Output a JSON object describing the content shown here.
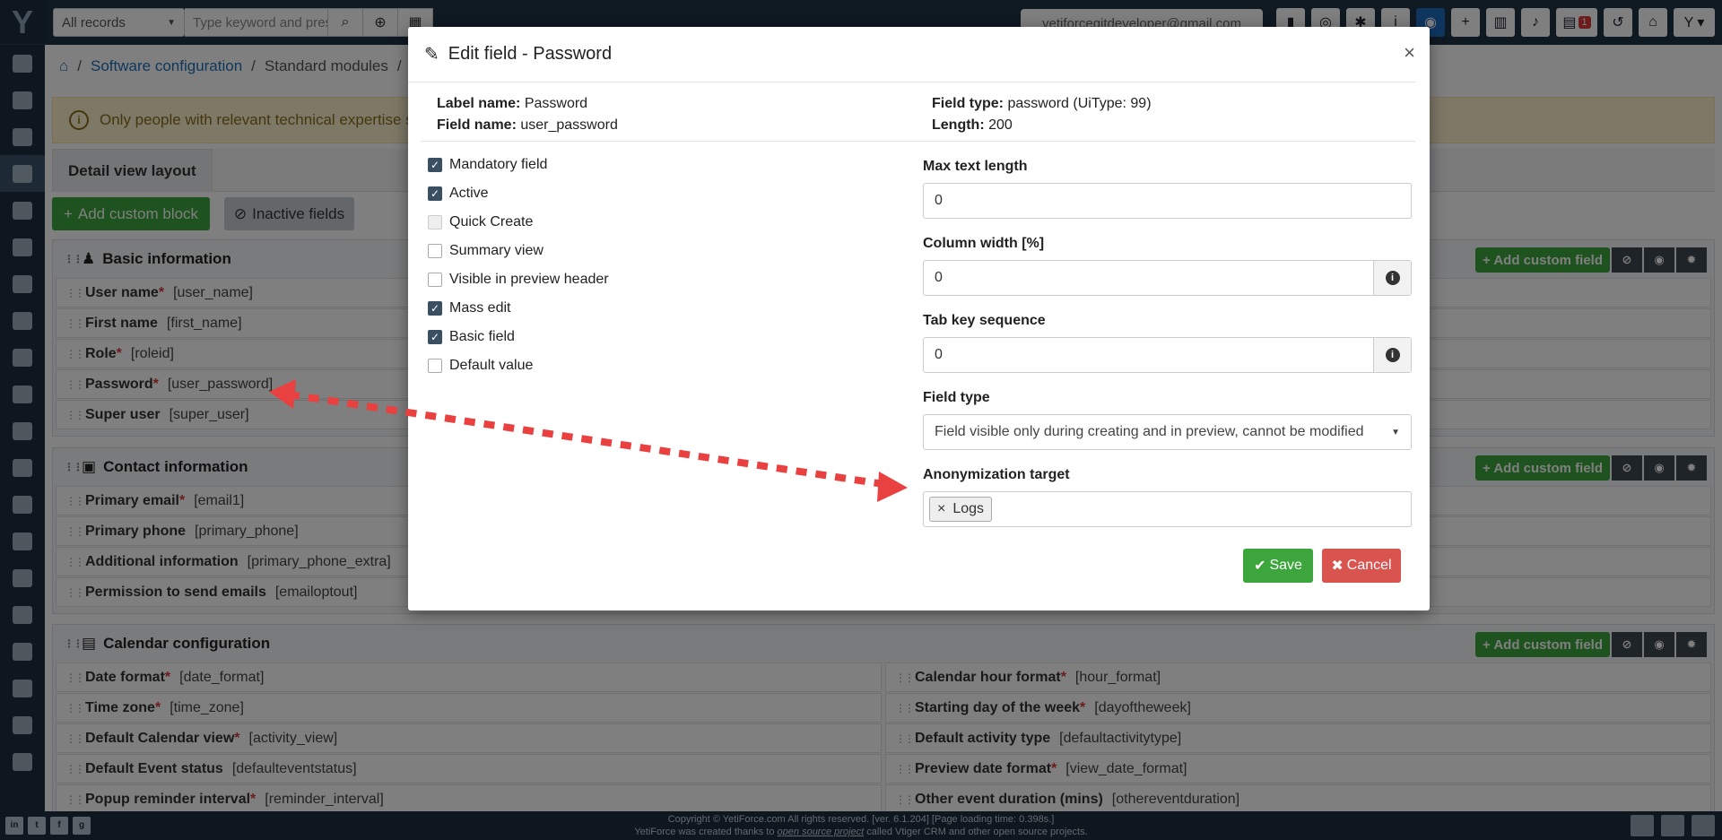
{
  "topbar": {
    "filter_select": "All records",
    "search_placeholder": "Type keyword and press",
    "user_email": "yetiforcegitdeveloper@gmail.com",
    "calendar_badge": "1"
  },
  "breadcrumb": [
    "Software configuration",
    "Standard modules"
  ],
  "alert_text": "Only people with relevant technical expertise sho",
  "tab_label": "Detail view layout",
  "actions": {
    "add_block": "Add custom block",
    "inactive_fields": "Inactive fields",
    "add_field": "Add custom field"
  },
  "blocks": {
    "basic": {
      "title": "Basic information",
      "fields": [
        {
          "name": "User name",
          "required": true,
          "key": "[user_name]"
        },
        {
          "name": "First name",
          "required": false,
          "key": "[first_name]"
        },
        {
          "name": "Role",
          "required": true,
          "key": "[roleid]"
        },
        {
          "name": "Password",
          "required": true,
          "key": "[user_password]"
        },
        {
          "name": "Super user",
          "required": false,
          "key": "[super_user]"
        }
      ]
    },
    "contact": {
      "title": "Contact information",
      "fields": [
        {
          "name": "Primary email",
          "required": true,
          "key": "[email1]"
        },
        {
          "name": "Primary phone",
          "required": false,
          "key": "[primary_phone]"
        },
        {
          "name": "Additional information",
          "required": false,
          "key": "[primary_phone_extra]"
        },
        {
          "name": "Permission to send emails",
          "required": false,
          "key": "[emailoptout]"
        }
      ]
    },
    "calendar": {
      "title": "Calendar configuration",
      "left": [
        {
          "name": "Date format",
          "required": true,
          "key": "[date_format]"
        },
        {
          "name": "Time zone",
          "required": true,
          "key": "[time_zone]"
        },
        {
          "name": "Default Calendar view",
          "required": true,
          "key": "[activity_view]"
        },
        {
          "name": "Default Event status",
          "required": false,
          "key": "[defaulteventstatus]"
        },
        {
          "name": "Popup reminder interval",
          "required": true,
          "key": "[reminder_interval]"
        }
      ],
      "right": [
        {
          "name": "Calendar hour format",
          "required": true,
          "key": "[hour_format]"
        },
        {
          "name": "Starting day of the week",
          "required": true,
          "key": "[dayoftheweek]"
        },
        {
          "name": "Default activity type",
          "required": false,
          "key": "[defaultactivitytype]"
        },
        {
          "name": "Preview date format",
          "required": true,
          "key": "[view_date_format]"
        },
        {
          "name": "Other event duration (mins)",
          "required": false,
          "key": "[othereventduration]"
        }
      ]
    }
  },
  "modal": {
    "title": "Edit field - Password",
    "label_name_caption": "Label name:",
    "label_name": "Password",
    "field_name_caption": "Field name:",
    "field_name": "user_password",
    "field_type_caption": "Field type:",
    "field_type": "password (UiType: 99)",
    "length_caption": "Length:",
    "length": "200",
    "checkboxes": [
      {
        "label": "Mandatory field",
        "checked": true,
        "disabled": false
      },
      {
        "label": "Active",
        "checked": true,
        "disabled": false
      },
      {
        "label": "Quick Create",
        "checked": false,
        "disabled": true
      },
      {
        "label": "Summary view",
        "checked": false,
        "disabled": false
      },
      {
        "label": "Visible in preview header",
        "checked": false,
        "disabled": false
      },
      {
        "label": "Mass edit",
        "checked": true,
        "disabled": false
      },
      {
        "label": "Basic field",
        "checked": true,
        "disabled": false
      },
      {
        "label": "Default value",
        "checked": false,
        "disabled": false
      }
    ],
    "max_text_length_label": "Max text length",
    "max_text_length": "0",
    "column_width_label": "Column width [%]",
    "column_width": "0",
    "tab_key_label": "Tab key sequence",
    "tab_key": "0",
    "field_type_label": "Field type",
    "field_type_select": "Field visible only during creating and in preview, cannot be modified",
    "anonymization_label": "Anonymization target",
    "anonymization_tag": "Logs",
    "save": "Save",
    "cancel": "Cancel"
  },
  "footer": {
    "line1": "Copyright © YetiForce.com All rights reserved. [ver. 6.1.204] [Page loading time: 0.398s.]",
    "line2_pre": "YetiForce was created thanks to ",
    "line2_link": "open source project",
    "line2_post": " called Vtiger CRM and other open source projects."
  },
  "colors": {
    "accent_green": "#3ca53c",
    "danger": "#d9534f",
    "sidebar": "#1c2e3f",
    "arrow": "#e94040"
  }
}
